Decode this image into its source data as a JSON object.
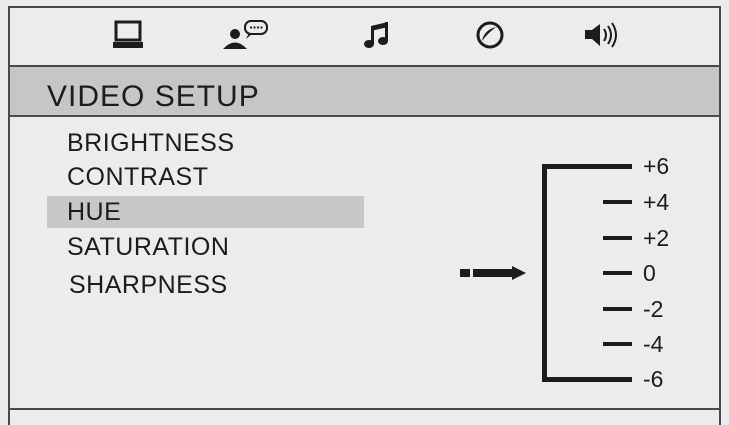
{
  "tabs": [
    {
      "icon": "monitor-icon"
    },
    {
      "icon": "person-speech-icon"
    },
    {
      "icon": "music-note-icon"
    },
    {
      "icon": "disc-icon"
    },
    {
      "icon": "speaker-icon"
    }
  ],
  "title": "VIDEO SETUP",
  "menu": {
    "items": [
      "BRIGHTNESS",
      "CONTRAST",
      "HUE",
      "SATURATION",
      "SHARPNESS"
    ],
    "selected": "HUE"
  },
  "scale": {
    "labels": [
      "+6",
      "+4",
      "+2",
      "0",
      "-2",
      "-4",
      "-6"
    ],
    "current": "0"
  },
  "colors": {
    "background": "#ececec",
    "bar": "#c6c6c6",
    "highlight": "#c8c8c8",
    "ink": "#1c1c1c"
  }
}
